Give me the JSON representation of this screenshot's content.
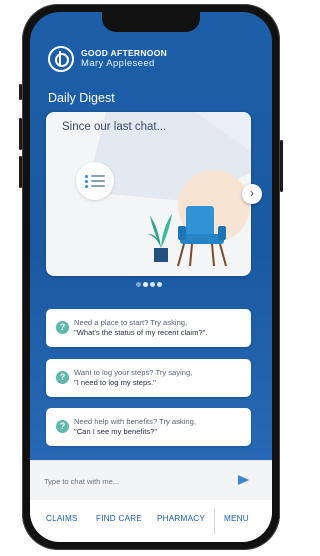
{
  "header": {
    "greeting": "GOOD AFTERNOON",
    "user_name": "Mary Appleseed"
  },
  "digest": {
    "title": "Daily Digest",
    "card_text": "Since our last chat...",
    "page_count": 4,
    "active_page": 1
  },
  "suggestions": [
    {
      "line1": "Need a place to start? Try asking,",
      "line2": "\"What's the status of my recent claim?\"."
    },
    {
      "line1": "Want to log your steps? Try saying,",
      "line2": "\"I need to log my steps.\""
    },
    {
      "line1": "Need help with benefits? Try asking,",
      "line2": "\"Can I see my benefits?\""
    }
  ],
  "chat": {
    "placeholder": "Type to chat with me..."
  },
  "nav": {
    "items": [
      "CLAIMS",
      "FIND CARE",
      "PHARMACY"
    ],
    "menu": "MENU"
  },
  "colors": {
    "brand_blue": "#1c5fa8",
    "accent_teal": "#5fb8a9",
    "chair_blue": "#2f93d6"
  }
}
